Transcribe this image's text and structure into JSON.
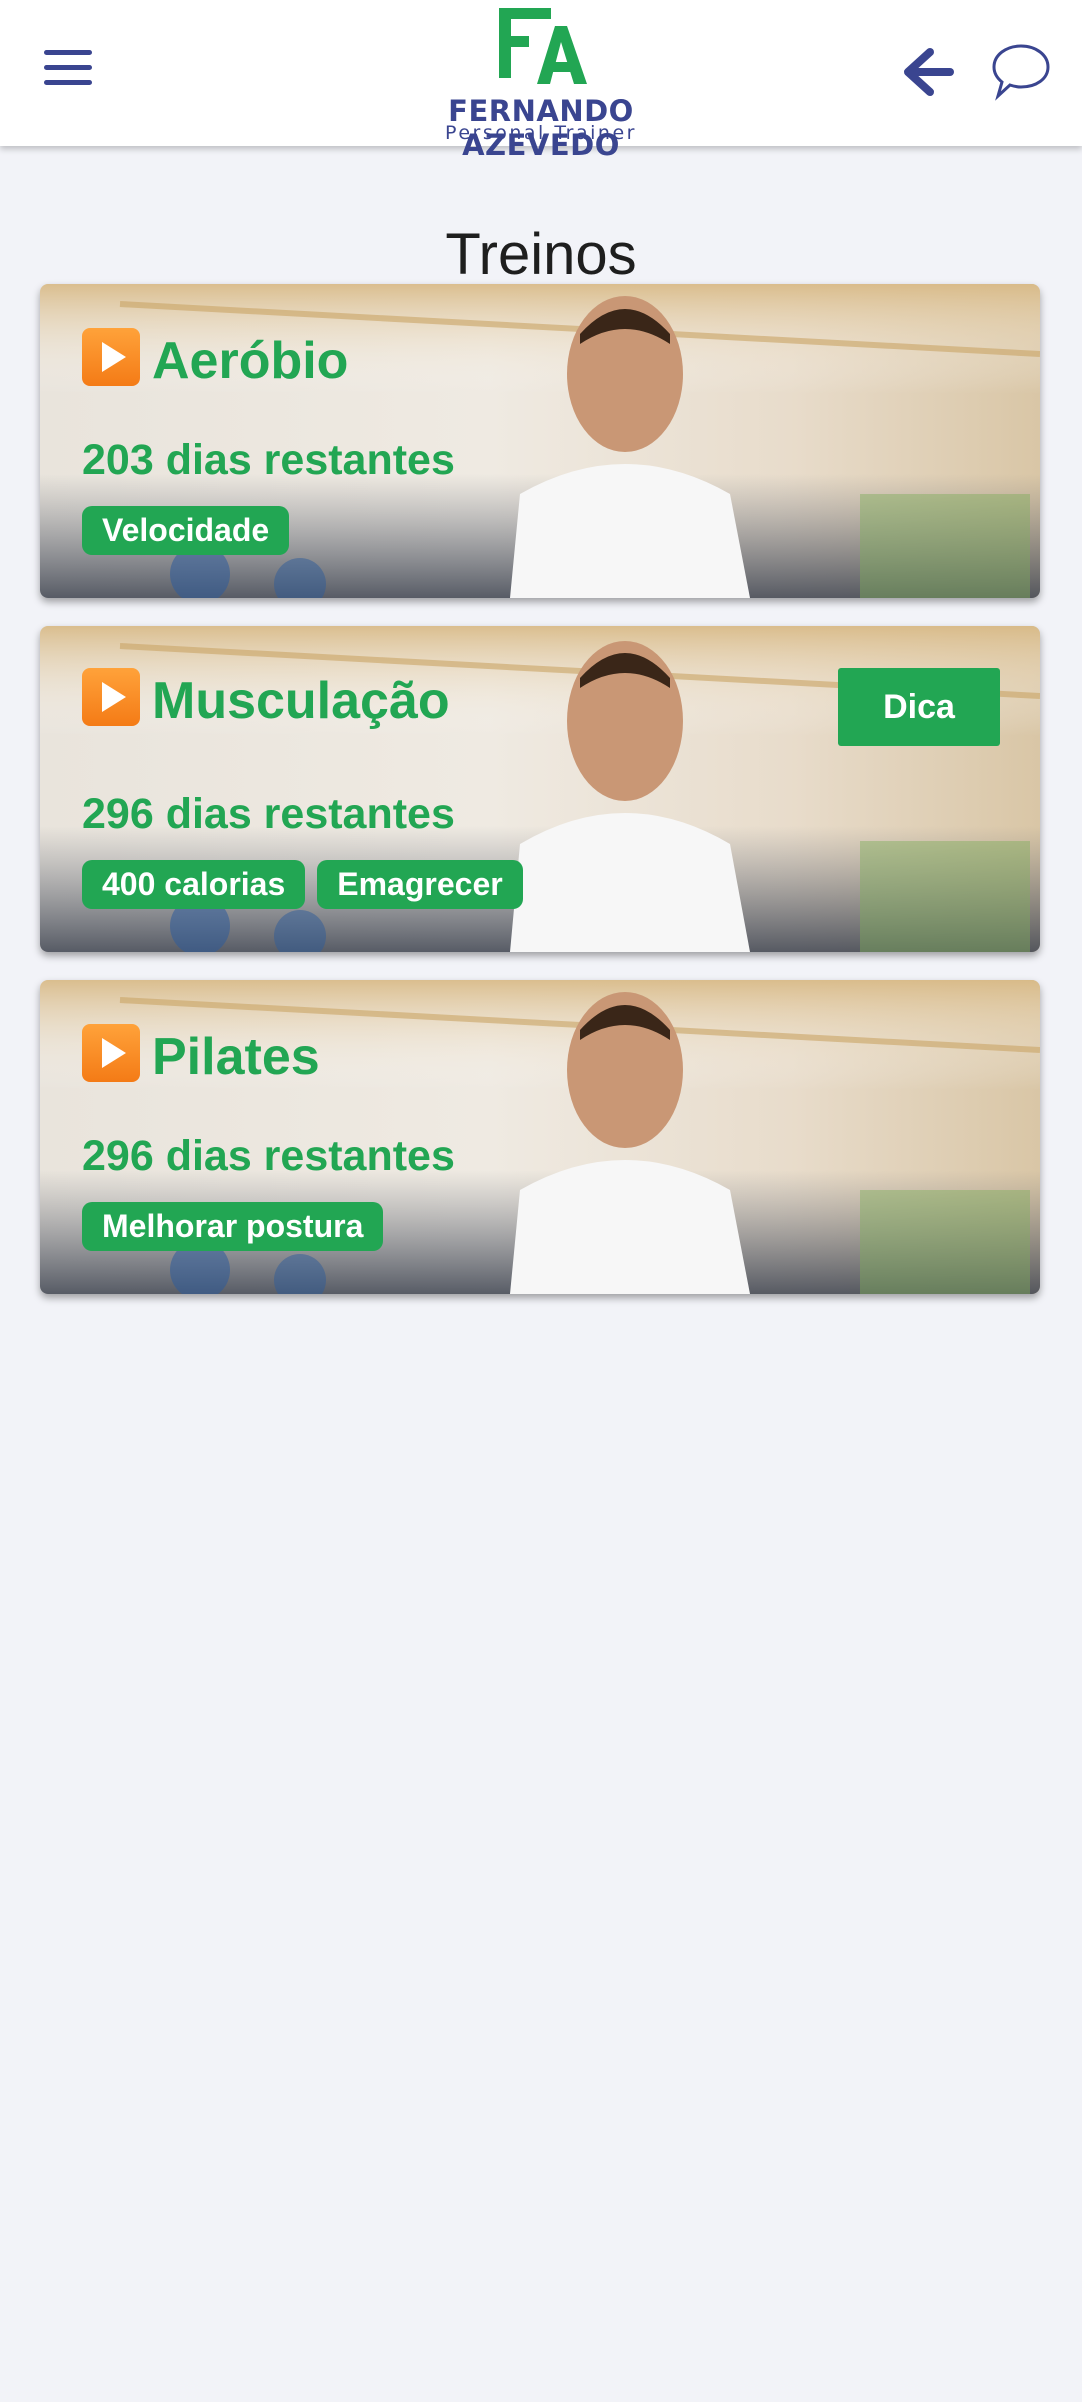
{
  "header": {
    "brand_name": "FERNANDO AZEVEDO",
    "brand_subtitle": "Personal Trainer",
    "logo_letters": "FA",
    "menu_icon": "hamburger-menu-icon",
    "back_icon": "arrow-left-icon",
    "chat_icon": "chat-bubble-icon"
  },
  "page": {
    "title": "Treinos"
  },
  "colors": {
    "brand_green": "#22a653",
    "brand_blue": "#3a4590",
    "background": "#f2f3f8",
    "play_icon": "#f47b16"
  },
  "workouts": [
    {
      "icon": "play-button-icon",
      "title": "Aeróbio",
      "days": "203 dias restantes",
      "tags": [
        "Velocidade"
      ]
    },
    {
      "icon": "play-button-icon",
      "title": "Musculação",
      "days": "296 dias restantes",
      "tags": [
        "400 calorias",
        "Emagrecer"
      ],
      "tip_label": "Dica"
    },
    {
      "icon": "play-button-icon",
      "title": "Pilates",
      "days": "296 dias restantes",
      "tags": [
        "Melhorar postura"
      ]
    }
  ]
}
